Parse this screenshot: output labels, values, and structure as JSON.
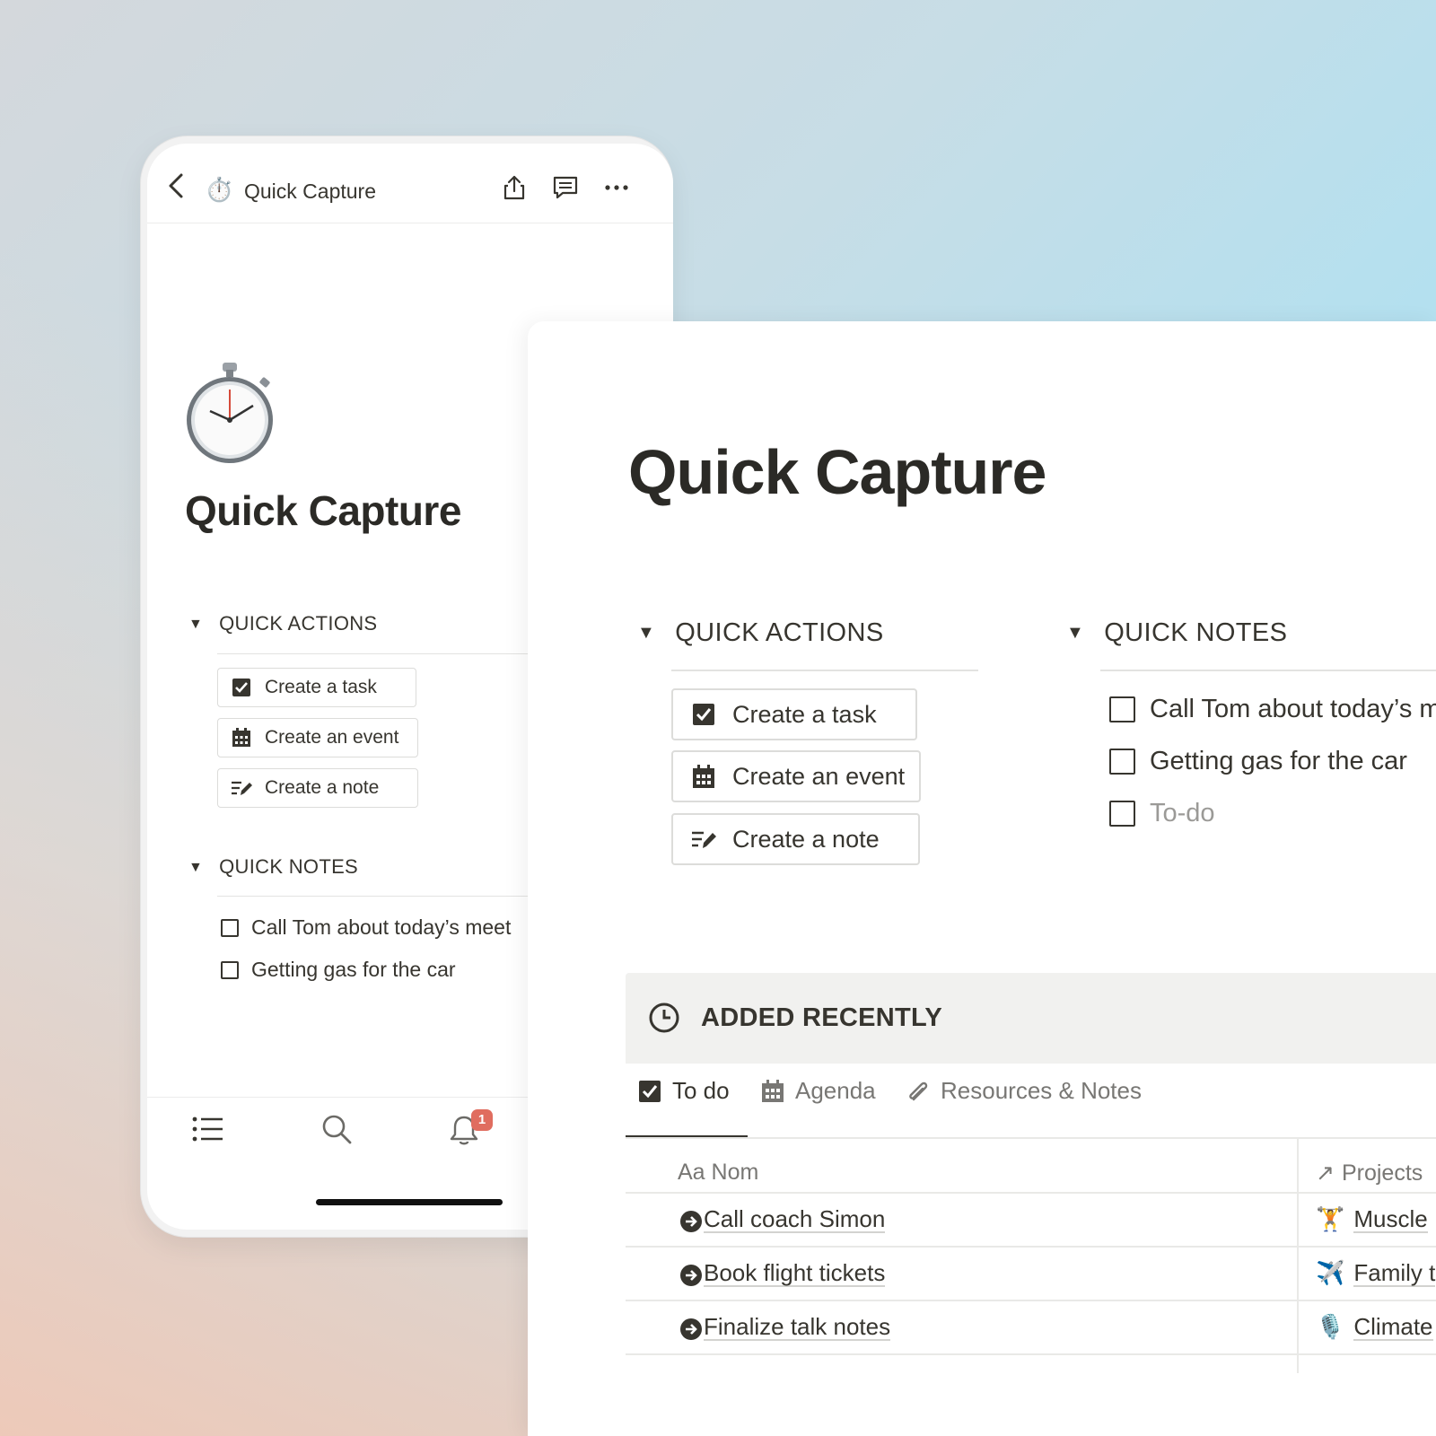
{
  "phone": {
    "tab_title": "Quick Capture",
    "page_emoji": "⏱️",
    "page_title": "Quick Capture",
    "quick_actions": {
      "heading": "QUICK ACTIONS",
      "buttons": [
        "Create a task",
        "Create an event",
        "Create a note"
      ]
    },
    "quick_notes": {
      "heading": "QUICK NOTES",
      "items": [
        "Call Tom about today’s meet",
        "Getting gas for the car"
      ]
    },
    "notification_count": "1"
  },
  "desktop": {
    "page_title": "Quick Capture",
    "quick_actions": {
      "heading": "QUICK ACTIONS",
      "buttons": [
        "Create a task",
        "Create an event",
        "Create a note"
      ]
    },
    "quick_notes": {
      "heading": "QUICK NOTES",
      "items": [
        "Call Tom about today’s m",
        "Getting gas for the car"
      ],
      "placeholder": "To-do"
    },
    "added_recently": {
      "heading": "ADDED RECENTLY",
      "tabs": [
        "To do",
        "Agenda",
        "Resources & Notes"
      ],
      "columns": {
        "name_prefix": "Aa",
        "name": "Nom",
        "projects": "Projects"
      },
      "rows": [
        {
          "name": "Call coach Simon",
          "project_emoji": "🏋️",
          "project": "Muscle"
        },
        {
          "name": "Book flight tickets",
          "project_emoji": "✈️",
          "project": "Family t"
        },
        {
          "name": "Finalize talk notes",
          "project_emoji": "🎙️",
          "project": "Climate"
        }
      ]
    }
  },
  "colors": {
    "text": "#37352f",
    "badge": "#e06d5f",
    "border": "#dcdcda",
    "muted": "#787774"
  }
}
